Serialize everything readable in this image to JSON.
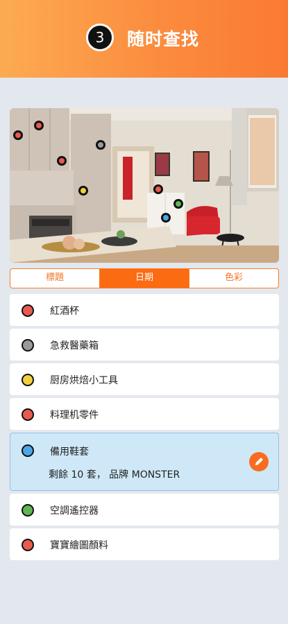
{
  "header": {
    "step_number": "3",
    "title": "随时查找",
    "colors": {
      "gradient_start": "#fcab52",
      "gradient_end": "#fa7a34"
    }
  },
  "photo": {
    "description_icon": "kitchen-room-photo",
    "markers": [
      {
        "color": "#e85a4f"
      },
      {
        "color": "#e85a4f"
      },
      {
        "color": "#9a9a9a"
      },
      {
        "color": "#e85a4f"
      },
      {
        "color": "#f0d13c"
      },
      {
        "color": "#e85a4f"
      },
      {
        "color": "#5fb650"
      },
      {
        "color": "#4aa6e8"
      }
    ]
  },
  "tabs": [
    {
      "label": "標題",
      "active": false
    },
    {
      "label": "日期",
      "active": true
    },
    {
      "label": "色彩",
      "active": false
    }
  ],
  "items": [
    {
      "label": "紅酒杯",
      "color": "#e85a4f"
    },
    {
      "label": "急救醫藥箱",
      "color": "#9a9a9a"
    },
    {
      "label": "厨房烘焙小工具",
      "color": "#f0d13c"
    },
    {
      "label": "料理机零件",
      "color": "#e85a4f"
    },
    {
      "label": "備用鞋套",
      "color": "#4aa6e8",
      "detail": "剩餘 10 套， 品牌 MONSTER",
      "selected": true,
      "edit_icon": "pencil-icon"
    },
    {
      "label": "空調遙控器",
      "color": "#5fb650"
    },
    {
      "label": "寶寶繪圖顏料",
      "color": "#e85a4f"
    }
  ]
}
